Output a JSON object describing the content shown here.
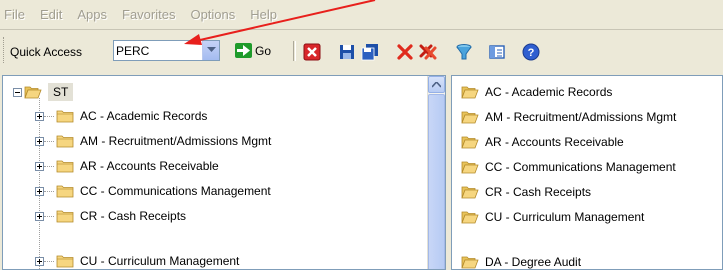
{
  "menu": {
    "items": [
      "File",
      "Edit",
      "Apps",
      "Favorites",
      "Options",
      "Help"
    ]
  },
  "toolbar": {
    "quick_access_label": "Quick Access",
    "quick_access_value": "PERC",
    "go_label": "Go",
    "icons": [
      "close-red-icon",
      "save-icon",
      "save-all-icon",
      "delete-icon",
      "delete-all-icon",
      "funnel-icon",
      "list-view-icon",
      "help-icon"
    ]
  },
  "tree": {
    "root_label": "ST",
    "children": [
      "AC - Academic Records",
      "AM - Recruitment/Admissions Mgmt",
      "AR - Accounts Receivable",
      "CC - Communications Management",
      "CR - Cash Receipts",
      "CU - Curriculum Management"
    ]
  },
  "list": {
    "items": [
      "AC - Academic Records",
      "AM - Recruitment/Admissions Mgmt",
      "AR - Accounts Receivable",
      "CC - Communications Management",
      "CR - Cash Receipts",
      "CU - Curriculum Management",
      "DA - Degree Audit"
    ]
  },
  "colors": {
    "annotation_arrow": "#e8201c",
    "folder_fill": "#f6d680",
    "go_green": "#1f9b2b"
  }
}
